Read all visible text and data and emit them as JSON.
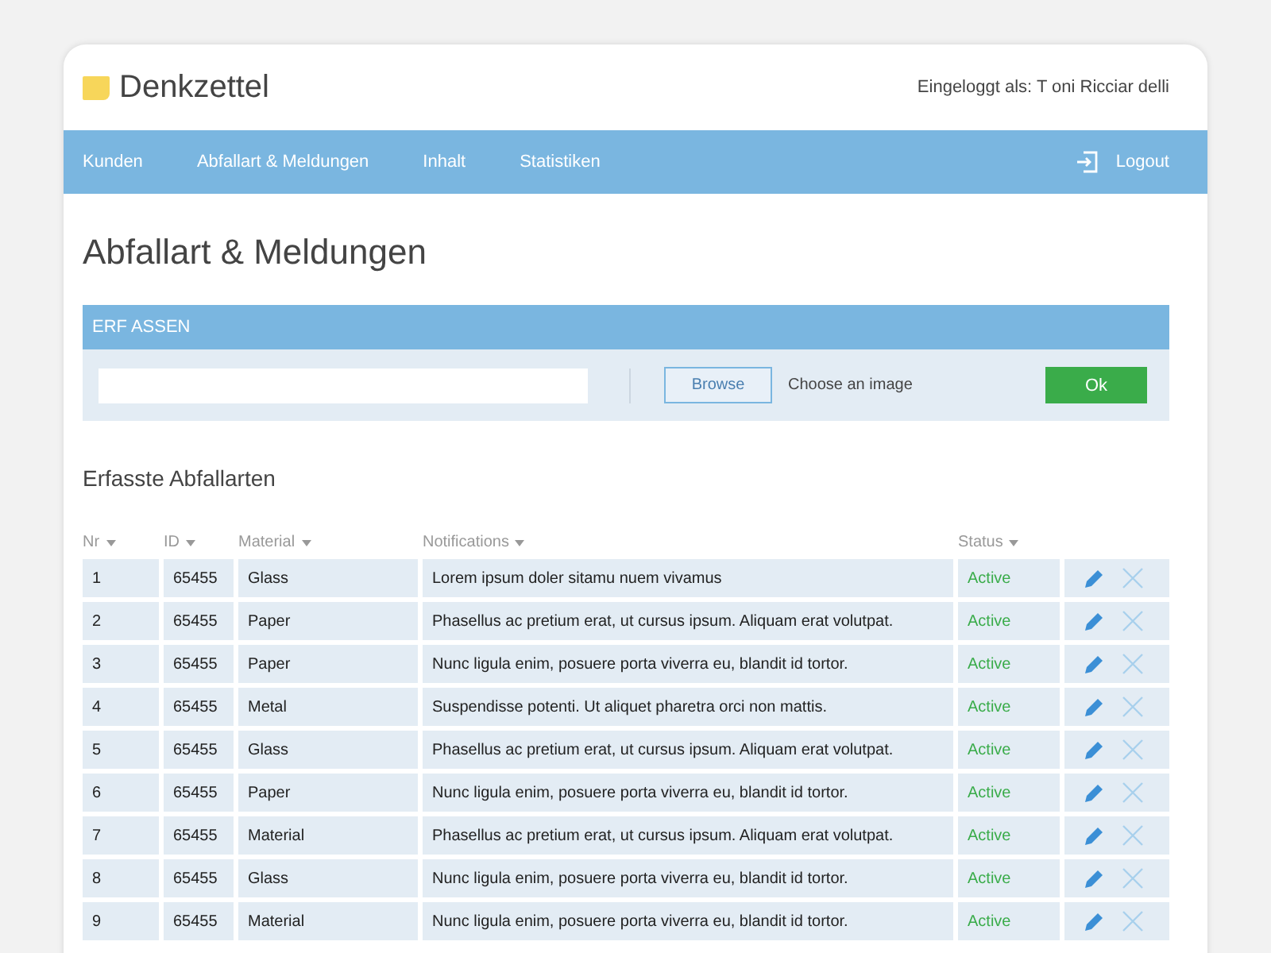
{
  "app": {
    "name": "Denkzettel",
    "user": "Eingeloggt als: T oni Ricciar delli"
  },
  "nav": {
    "items": [
      {
        "label": "Kunden"
      },
      {
        "label": "Abfallart & Meldungen"
      },
      {
        "label": "Inhalt"
      },
      {
        "label": "Statistiken"
      }
    ],
    "logout": "Logout"
  },
  "page_title": "Abfallart & Meldungen",
  "form": {
    "title": "ERF ASSEN",
    "browse": "Browse",
    "file_hint": "Choose an image",
    "ok": "Ok"
  },
  "table": {
    "title": "Erfasste Abfallarten",
    "columns": [
      "Nr",
      "ID",
      "Material",
      "Notifications",
      "Status"
    ],
    "rows": [
      {
        "nr": "1",
        "id": "65455",
        "material": "Glass",
        "notification": "Lorem ipsum doler sitamu nuem vivamus",
        "status": "Active"
      },
      {
        "nr": "2",
        "id": "65455",
        "material": "Paper",
        "notification": "Phasellus ac pretium erat, ut cursus ipsum. Aliquam erat volutpat.",
        "status": "Active"
      },
      {
        "nr": "3",
        "id": "65455",
        "material": "Paper",
        "notification": "Nunc ligula enim, posuere porta viverra eu, blandit id tortor.",
        "status": "Active"
      },
      {
        "nr": "4",
        "id": "65455",
        "material": "Metal",
        "notification": "Suspendisse potenti. Ut aliquet pharetra orci non mattis.",
        "status": "Active"
      },
      {
        "nr": "5",
        "id": "65455",
        "material": "Glass",
        "notification": "Phasellus ac pretium erat, ut cursus ipsum. Aliquam erat volutpat.",
        "status": "Active"
      },
      {
        "nr": "6",
        "id": "65455",
        "material": "Paper",
        "notification": "Nunc ligula enim, posuere porta viverra eu, blandit id tortor.",
        "status": "Active"
      },
      {
        "nr": "7",
        "id": "65455",
        "material": "Material",
        "notification": "Phasellus ac pretium erat, ut cursus ipsum. Aliquam erat volutpat.",
        "status": "Active"
      },
      {
        "nr": "8",
        "id": "65455",
        "material": "Glass",
        "notification": "Nunc ligula enim, posuere porta viverra eu, blandit id tortor.",
        "status": "Active"
      },
      {
        "nr": "9",
        "id": "65455",
        "material": "Material",
        "notification": "Nunc ligula enim, posuere porta viverra eu, blandit id tortor.",
        "status": "Active"
      }
    ]
  }
}
